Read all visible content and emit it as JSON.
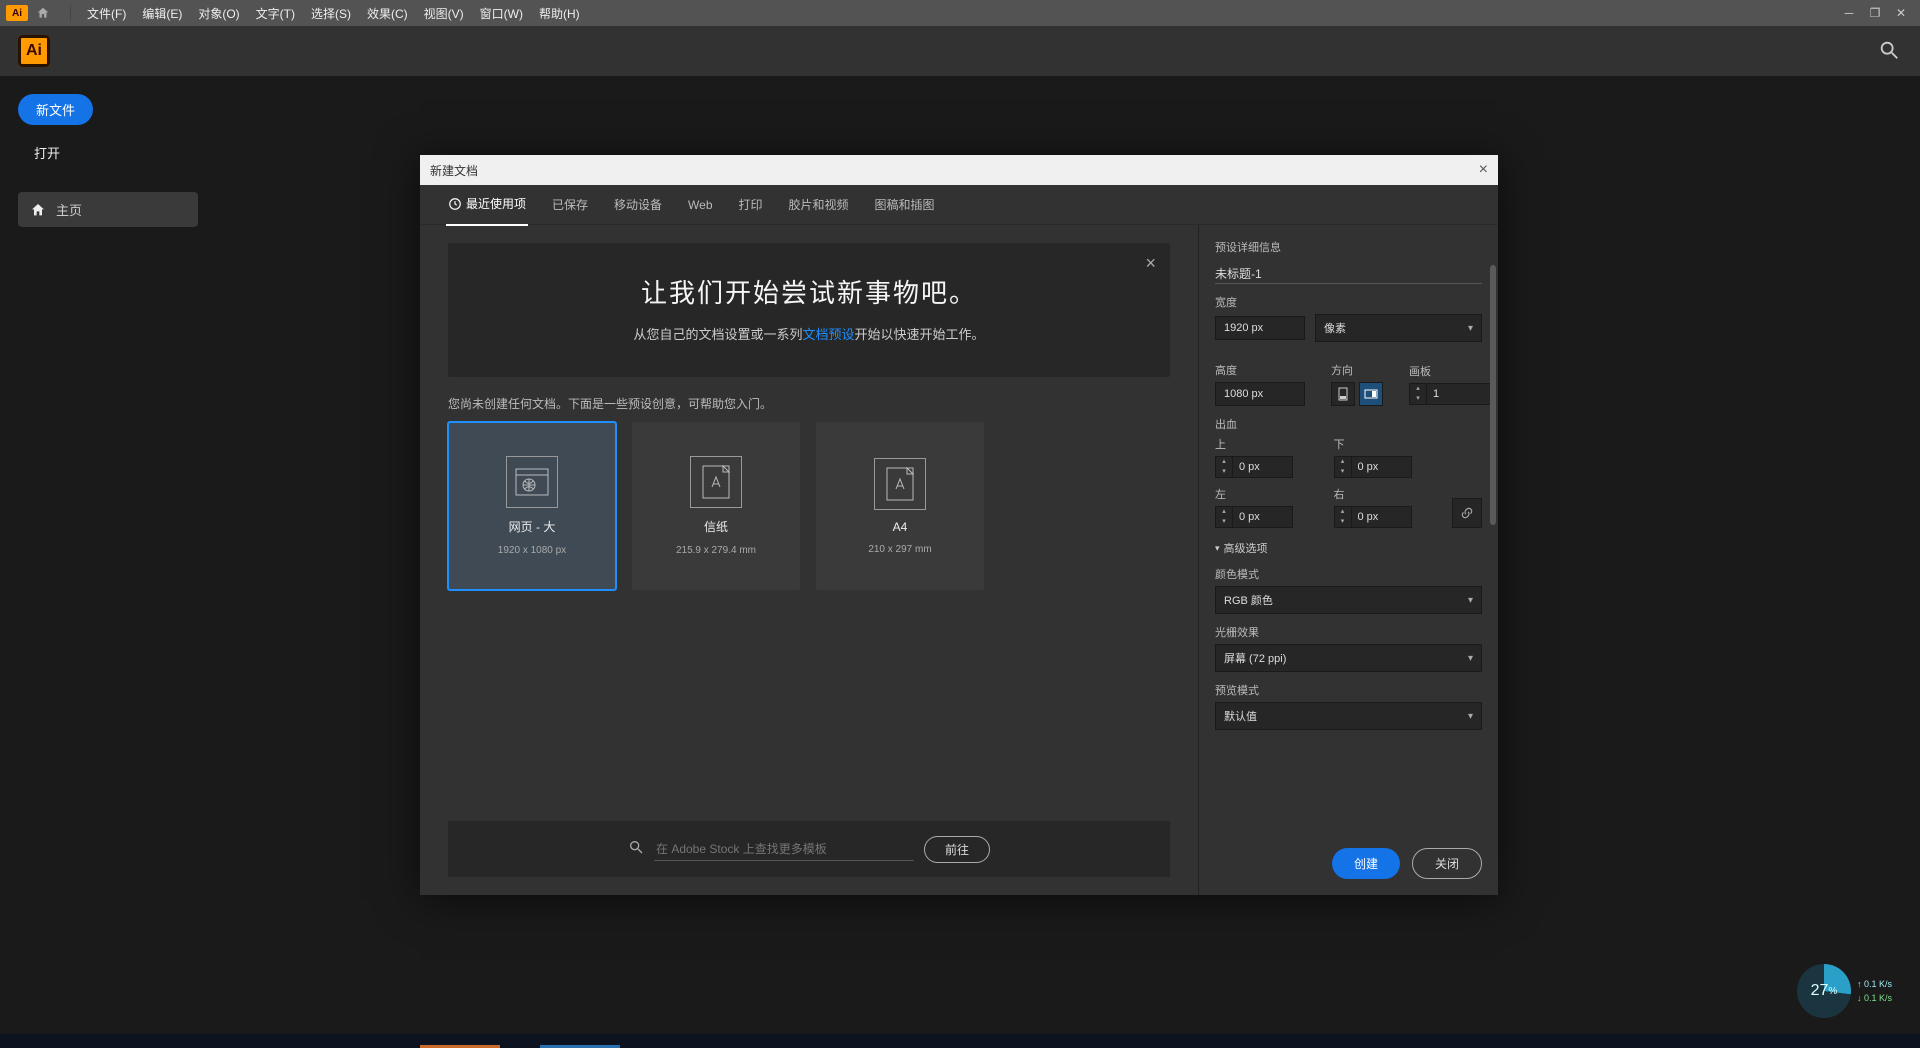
{
  "menubar": {
    "items": [
      "文件(F)",
      "编辑(E)",
      "对象(O)",
      "文字(T)",
      "选择(S)",
      "效果(C)",
      "视图(V)",
      "窗口(W)",
      "帮助(H)"
    ]
  },
  "sidebar": {
    "new_file": "新文件",
    "open": "打开",
    "home": "主页"
  },
  "dialog": {
    "title": "新建文档",
    "tabs": [
      "最近使用项",
      "已保存",
      "移动设备",
      "Web",
      "打印",
      "胶片和视频",
      "图稿和插图"
    ],
    "hero": {
      "title": "让我们开始尝试新事物吧。",
      "sub_pre": "从您自己的文档设置或一系列",
      "sub_link": "文档预设",
      "sub_post": "开始以快速开始工作。"
    },
    "hint": "您尚未创建任何文档。下面是一些预设创意，可帮助您入门。",
    "presets": [
      {
        "name": "网页 - 大",
        "dim": "1920 x 1080 px"
      },
      {
        "name": "信纸",
        "dim": "215.9 x 279.4 mm"
      },
      {
        "name": "A4",
        "dim": "210 x 297 mm"
      }
    ],
    "stock": {
      "placeholder": "在 Adobe Stock 上查找更多模板",
      "go": "前往"
    },
    "details": {
      "header": "预设详细信息",
      "name": "未标题-1",
      "width_label": "宽度",
      "width": "1920 px",
      "unit": "像素",
      "height_label": "高度",
      "height": "1080 px",
      "orient_label": "方向",
      "artboard_label": "画板",
      "artboards": "1",
      "bleed_label": "出血",
      "top": "上",
      "bottom": "下",
      "left": "左",
      "right": "右",
      "bleed_val": "0 px",
      "advanced": "高级选项",
      "color_mode_label": "颜色模式",
      "color_mode": "RGB 颜色",
      "raster_label": "光栅效果",
      "raster": "屏幕 (72 ppi)",
      "preview_label": "预览模式",
      "preview": "默认值"
    },
    "buttons": {
      "create": "创建",
      "close": "关闭"
    }
  },
  "perf": {
    "pct": "27",
    "up": "0.1",
    "dn": "0.1",
    "unit": "K/s"
  }
}
